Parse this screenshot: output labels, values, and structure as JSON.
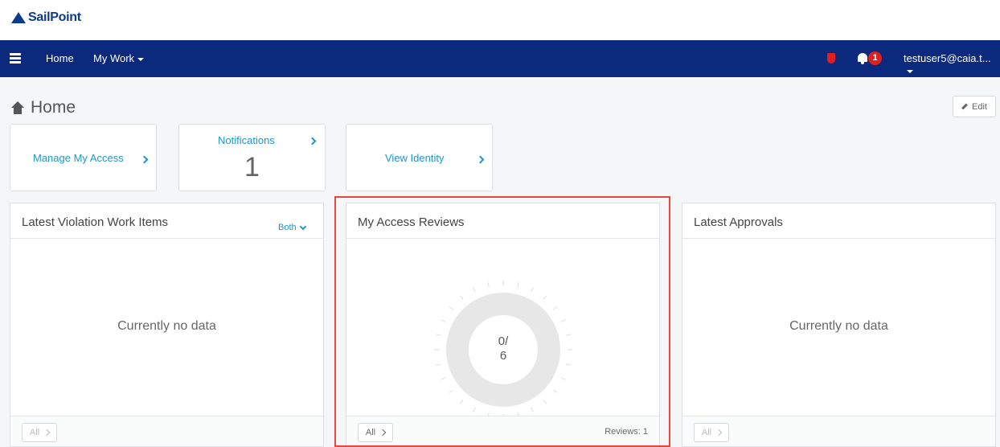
{
  "brand": {
    "name": "SailPoint"
  },
  "navbar": {
    "menu_icon": "list-icon",
    "home_label": "Home",
    "mywork_label": "My Work",
    "shield_icon": "shield-icon",
    "bell_icon": "bell-icon",
    "notification_count": "1",
    "user_label": "testuser5@caia.t..."
  },
  "page": {
    "title": "Home",
    "edit_label": "Edit"
  },
  "tiles": {
    "manage_access": {
      "label": "Manage My Access"
    },
    "notifications": {
      "label": "Notifications",
      "count": "1"
    },
    "view_identity": {
      "label": "View Identity"
    }
  },
  "panels": {
    "violations": {
      "title": "Latest Violation Work Items",
      "filter": "Both",
      "empty": "Currently no data",
      "footer_button": "All"
    },
    "access_reviews": {
      "title": "My Access Reviews",
      "gauge_top": "0/",
      "gauge_bottom": "6",
      "completed": 0,
      "total": 6,
      "footer_button": "All",
      "footer_count": "Reviews: 1"
    },
    "approvals": {
      "title": "Latest Approvals",
      "empty": "Currently no data",
      "footer_button": "All"
    }
  },
  "colors": {
    "navbar": "#0b2a7d",
    "link": "#1d96c8",
    "alert": "#e02020",
    "highlight": "#e8473f"
  }
}
